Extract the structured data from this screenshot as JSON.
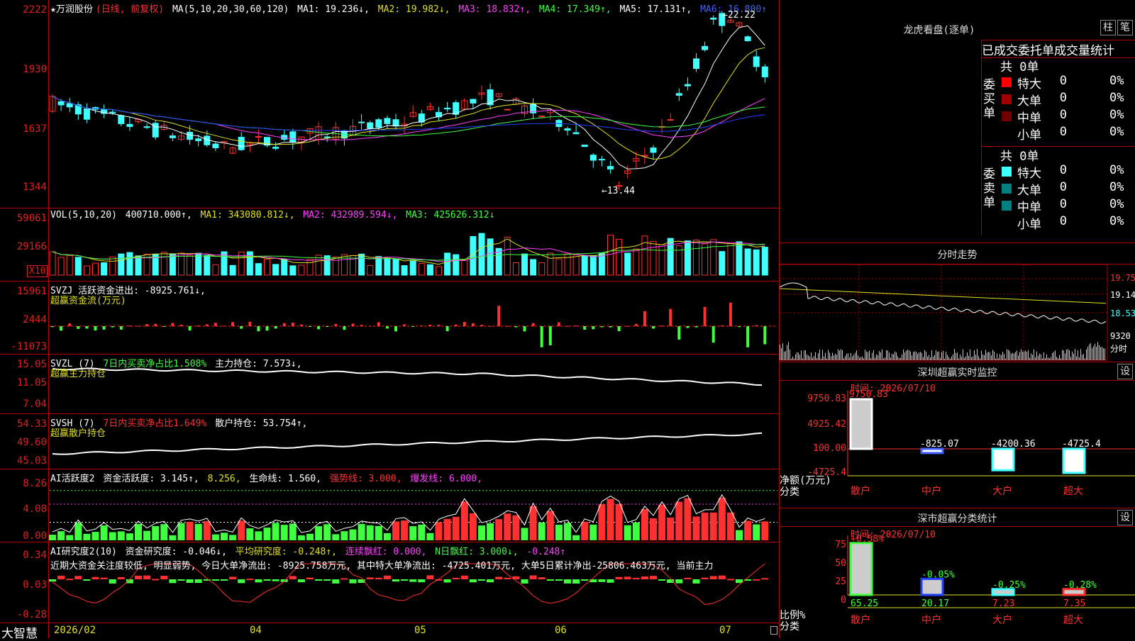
{
  "app": {
    "name": "大智慧"
  },
  "colors": {
    "up": "#ff3030",
    "down": "#40ffff",
    "ma1": "#ffffff",
    "ma2": "#e0e020",
    "ma3": "#ff40ff",
    "ma4": "#40ff40",
    "ma5": "#2040ff",
    "frame": "#b00000"
  },
  "main": {
    "stock": "★万润股份",
    "mode": "(日线, 前复权)",
    "ma_label": "MA(5,10,20,30,60,120)",
    "ma1": "MA1: 19.236↓,",
    "ma2": "MA2: 19.982↓,",
    "ma3": "MA3: 18.832↑,",
    "ma4": "MA4: 17.349↑,",
    "ma5": "MA5: 17.131↑,",
    "ma6": "MA6: 16.800↑",
    "y_labels": [
      "2222",
      "1930",
      "1637",
      "1344"
    ],
    "hi_mark": "←22.22",
    "lo_mark": "←13.44"
  },
  "vol": {
    "label": "VOL(5,10,20)",
    "value": "400710.000↑,",
    "ma1": "MA1: 343080.812↓,",
    "ma2": "MA2: 432989.594↓,",
    "ma3": "MA3: 425626.312↓",
    "y_labels": [
      "59061",
      "29166"
    ],
    "unit": "X10"
  },
  "svzj": {
    "label": "SVZJ  活跃资金进出: -8925.761↓,",
    "sub": "超赢资金流(万元)",
    "y_labels": [
      "15961",
      "2444",
      "-11073"
    ]
  },
  "svzl": {
    "name": "SVZL (7)",
    "desc": "7日内买卖净占比1.508%",
    "value": "主力持仓: 7.573↓,",
    "sub": "超赢主力持仓",
    "y_labels": [
      "15.05",
      "11.05",
      "7.04"
    ]
  },
  "svsh": {
    "name": "SVSH (7)",
    "desc": "7日内买卖净占比1.649%",
    "value": "散户持仓: 53.754↑,",
    "sub": "超赢散户持仓",
    "y_labels": [
      "54.33",
      "49.60",
      "45.03"
    ]
  },
  "ai1": {
    "name": "AI活跃度2",
    "v1": "资金活跃度: 3.145↑,",
    "v2": "8.256,",
    "v3": "生命线: 1.560,",
    "v4": "强势线: 3.000,",
    "v5": "爆发线: 6.000,",
    "y_labels": [
      "8.26",
      "4.08",
      "0.00"
    ]
  },
  "ai2": {
    "name": "AI研究度2(10)",
    "v1": "资金研究度: -0.046↓,",
    "v2": "平均研究度: -0.248↑,",
    "v3": "连续飘红: 0.000,",
    "v4": "N日飘红: 3.000↓,",
    "v5": "-0.248↑",
    "text": "近期大资金关注度较低, 明显弱势, 今日大单净流出: -8925.758万元, 其中特大单净流出: -4725.401万元, 大单5日累计净出-25806.463万元, 当前主力",
    "y_labels": [
      "0.34",
      "0.03",
      "-0.28"
    ]
  },
  "dates": [
    "2026/02",
    "04",
    "05",
    "06",
    "07"
  ],
  "longhu": {
    "title": "龙虎看盘(逐单)",
    "btn_zhu": "柱",
    "btn_bi": "笔",
    "tabs": [
      "已成交",
      "委托单",
      "成交量统计"
    ],
    "buy_label": "委买单",
    "sell_label": "委卖单",
    "buy_total": "共 0单",
    "sell_total": "共 0单",
    "buy_rows": [
      {
        "name": "特大",
        "count": "0",
        "pct": "0%",
        "color": "#ff0000"
      },
      {
        "name": "大单",
        "count": "0",
        "pct": "0%",
        "color": "#a00000"
      },
      {
        "name": "中单",
        "count": "0",
        "pct": "0%",
        "color": "#700000"
      },
      {
        "name": "小单",
        "count": "0",
        "pct": "0%",
        "color": ""
      }
    ],
    "sell_rows": [
      {
        "name": "特大",
        "count": "0",
        "pct": "0%",
        "color": "#40ffff"
      },
      {
        "name": "大单",
        "count": "0",
        "pct": "0%",
        "color": "#008080"
      },
      {
        "name": "中单",
        "count": "0",
        "pct": "0%",
        "color": "#008080"
      },
      {
        "name": "小单",
        "count": "0",
        "pct": "0%",
        "color": ""
      }
    ]
  },
  "fenshi": {
    "title": "分时走势",
    "y_labels": [
      "19.75",
      "19.14",
      "18.53"
    ],
    "vol_label": "9320",
    "unit": "分时"
  },
  "monitor": {
    "title": "深圳超赢实时监控",
    "btn": "设",
    "time": "时间: 2026/07/10",
    "y_labels": [
      "9750.83",
      "4925.42",
      "100.00",
      "-4725.4"
    ],
    "axis_label": "净额(万元)",
    "axis_sub": "分类",
    "bars": [
      {
        "name": "散户",
        "value": 9750.83,
        "label": "9750.83"
      },
      {
        "name": "中户",
        "value": -825.07,
        "label": "-825.07"
      },
      {
        "name": "大户",
        "value": -4200.36,
        "label": "-4200.36"
      },
      {
        "name": "超大",
        "value": -4725.4,
        "label": "-4725.4"
      }
    ]
  },
  "classify": {
    "title": "深市超赢分类统计",
    "btn": "设",
    "time": "时间: 2026/07/10",
    "y_labels": [
      "75",
      "50",
      "25",
      "0"
    ],
    "axis_label": "比例%",
    "axis_sub": "分类",
    "bars": [
      {
        "name": "散户",
        "value": 65.25,
        "change": "+0.58%",
        "color": "#40ff40"
      },
      {
        "name": "中户",
        "value": 20.17,
        "change": "-0.05%",
        "color": "#2040ff"
      },
      {
        "name": "大户",
        "value": 7.23,
        "change": "-0.25%",
        "color": "#40ffff"
      },
      {
        "name": "超大",
        "value": 7.35,
        "change": "-0.28%",
        "color": "#ff3030"
      }
    ],
    "value_labels": [
      "65.25",
      "20.17",
      "7.23",
      "7.35"
    ]
  }
}
